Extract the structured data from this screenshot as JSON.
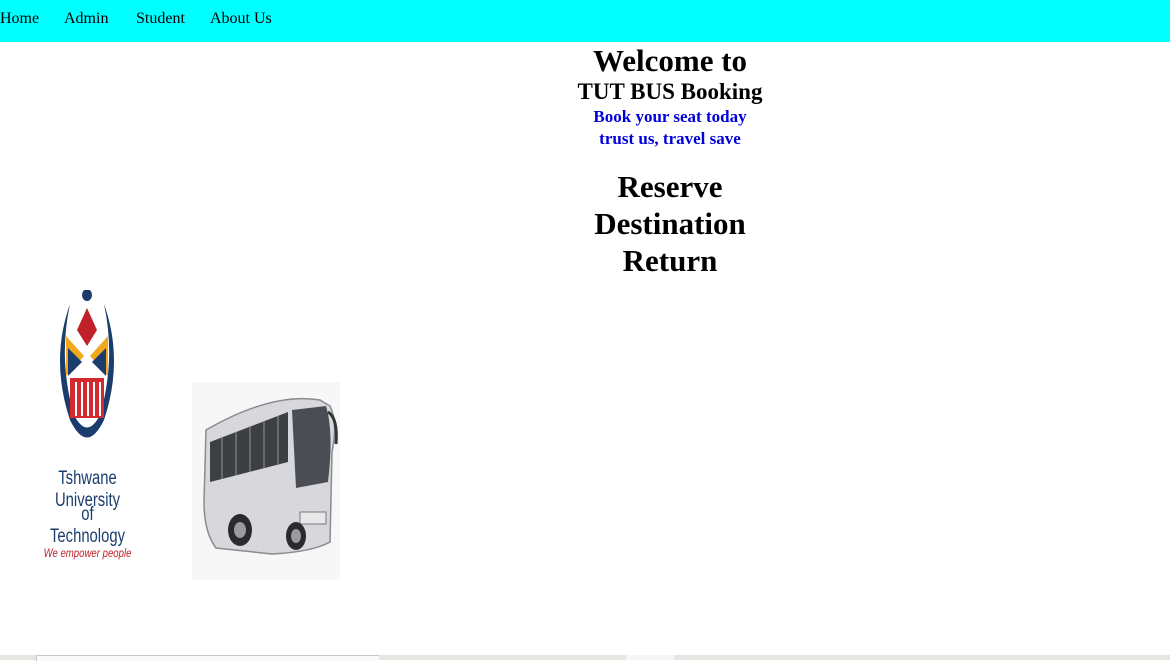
{
  "nav": {
    "items": [
      {
        "label": "Home"
      },
      {
        "label": "Admin"
      },
      {
        "label": "Student"
      },
      {
        "label": "About Us"
      }
    ],
    "background": "#00ffff"
  },
  "hero": {
    "welcome": "Welcome to",
    "title": "TUT BUS Booking",
    "tagline_1": "Book your seat today",
    "tagline_2": "trust us, travel save",
    "tagline_color": "#0000dd"
  },
  "menu": {
    "items": [
      {
        "label": "Reserve"
      },
      {
        "label": "Destination"
      },
      {
        "label": "Return"
      }
    ]
  },
  "logo": {
    "line_1": "Tshwane University",
    "line_2": "of Technology",
    "slogan": "We empower people",
    "icon": "tut-logo-icon"
  },
  "bus_image": {
    "icon": "bus-icon"
  }
}
